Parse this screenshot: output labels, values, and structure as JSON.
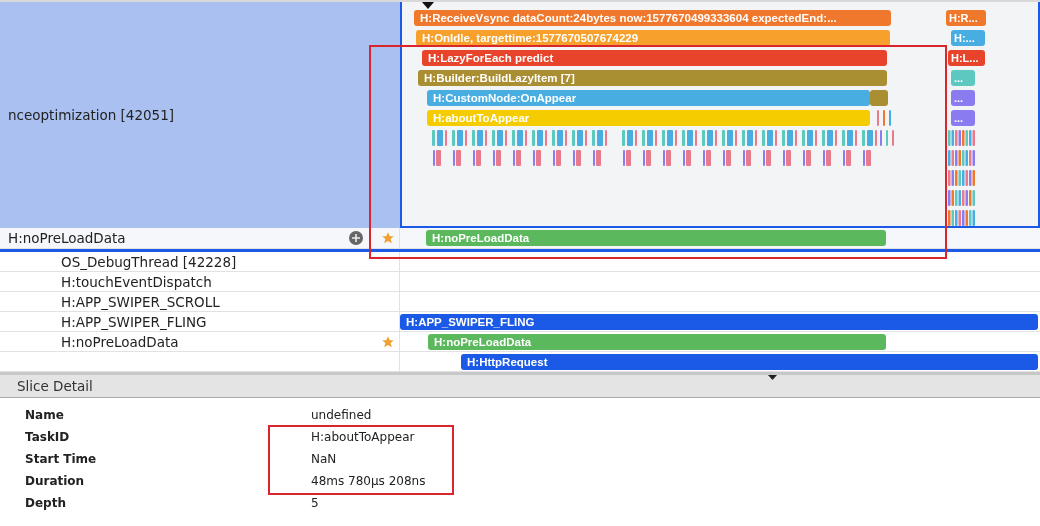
{
  "process_track": {
    "name": "nceoptimization [42051]",
    "slices": [
      {
        "label": "H:ReceiveVsync dataCount:24bytes now:1577670499333604 expectedEnd:...",
        "color": "#f0782c"
      },
      {
        "label": "H:OnIdle, targettime:1577670507674229",
        "color": "#f7a02c"
      },
      {
        "label": "H:LazyForEach predict",
        "color": "#e8442c"
      },
      {
        "label": "H:Builder:BuildLazyItem [7]",
        "color": "#a98e32"
      },
      {
        "label": "H:CustomNode:OnAppear",
        "color": "#48aee2"
      },
      {
        "label": "H:aboutToAppear",
        "color": "#f5cc00"
      }
    ],
    "overflow_slices": [
      {
        "label": "H:R...",
        "color": "#f0782c"
      },
      {
        "label": "H:...",
        "color": "#48aee2"
      },
      {
        "label": "H:L...",
        "color": "#e8442c"
      },
      {
        "label": "...",
        "color": "#5cc8c0"
      },
      {
        "label": "...",
        "color": "#8a7cf0"
      },
      {
        "label": "...",
        "color": "#8a7cf0"
      }
    ]
  },
  "pinned_row": {
    "name": "H:noPreLoadData",
    "starred": true,
    "slice": {
      "label": "H:noPreLoadData",
      "color": "#5cb85c"
    }
  },
  "thread_rows": [
    {
      "name": "OS_DebugThread [42228]",
      "starred": false
    },
    {
      "name": "H:touchEventDispatch",
      "starred": false
    },
    {
      "name": "H:APP_SWIPER_SCROLL",
      "starred": false
    },
    {
      "name": "H:APP_SWIPER_FLING",
      "starred": false,
      "slice": {
        "label": "H:APP_SWIPER_FLING",
        "color": "#1a5ae6"
      }
    },
    {
      "name": "H:noPreLoadData",
      "starred": true,
      "slice": {
        "label": "H:noPreLoadData",
        "color": "#5cb85c"
      }
    },
    {
      "starred": false,
      "slice": {
        "label": "H:HttpRequest",
        "color": "#1a5ae6"
      }
    }
  ],
  "slice_detail": {
    "title": "Slice Detail",
    "fields": [
      {
        "label": "Name",
        "value": "undefined"
      },
      {
        "label": "TaskID",
        "value": "H:aboutToAppear"
      },
      {
        "label": "Start Time",
        "value": "NaN"
      },
      {
        "label": "Duration",
        "value": "48ms 780μs 208ns"
      },
      {
        "label": "Depth",
        "value": "5"
      }
    ]
  },
  "annotations": [
    {
      "kind": "box"
    },
    {
      "kind": "box"
    }
  ]
}
